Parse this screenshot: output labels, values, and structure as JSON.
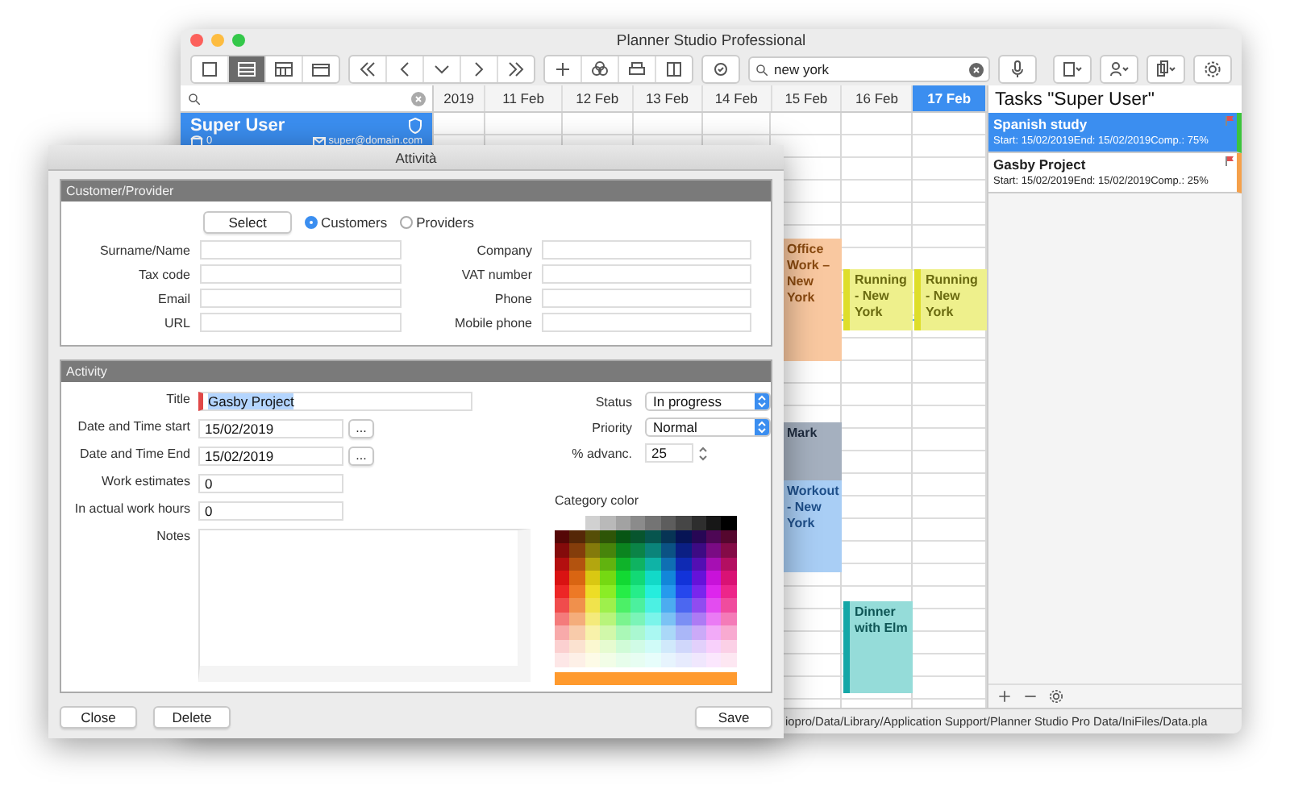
{
  "main_window": {
    "title": "Planner Studio Professional",
    "toolbar": {
      "search": "new york"
    },
    "sidebar": {
      "user": {
        "name": "Super User",
        "count": "0",
        "email": "super@domain.com",
        "selected": true
      }
    },
    "calendar": {
      "columns": [
        {
          "label": "2019",
          "selected": false
        },
        {
          "label": "11 Feb",
          "selected": false
        },
        {
          "label": "12 Feb",
          "selected": false
        },
        {
          "label": "13 Feb",
          "selected": false
        },
        {
          "label": "14 Feb",
          "selected": false
        },
        {
          "label": "15 Feb",
          "selected": false
        },
        {
          "label": "16 Feb",
          "selected": false
        },
        {
          "label": "17 Feb",
          "selected": true
        }
      ],
      "events": [
        {
          "title": "Office Work – New York",
          "color": "#f9c8a0"
        },
        {
          "title": "Running - New York",
          "color": "#eef08c"
        },
        {
          "title": "Running - New York",
          "color": "#eef08c"
        },
        {
          "title": "Mark",
          "color": "#a5b0bf"
        },
        {
          "title": "Workout - New York",
          "color": "#a9cef5"
        },
        {
          "title": "Dinner with Elm",
          "color": "#95dcd9"
        }
      ]
    },
    "tasks": {
      "title": "Tasks \"Super User\"",
      "items": [
        {
          "name": "Spanish study",
          "detail": "Start: 15/02/2019End: 15/02/2019Comp.: 75%",
          "selected": true,
          "color": "#3cc43c"
        },
        {
          "name": "Gasby Project",
          "detail": "Start: 15/02/2019End: 15/02/2019Comp.: 25%",
          "selected": false,
          "color": "#f5a04a"
        }
      ]
    },
    "status_bar": "iopro/Data/Library/Application Support/Planner Studio Pro Data/IniFiles/Data.pla"
  },
  "dialog": {
    "title": "Attività",
    "customer_section": {
      "title": "Customer/Provider",
      "select_button": "Select",
      "radios": [
        {
          "label": "Customers",
          "selected": true
        },
        {
          "label": "Providers",
          "selected": false
        }
      ],
      "fields_left": [
        {
          "label": "Surname/Name"
        },
        {
          "label": "Tax code"
        },
        {
          "label": "Email"
        },
        {
          "label": "URL"
        }
      ],
      "fields_right": [
        {
          "label": "Company"
        },
        {
          "label": "VAT number"
        },
        {
          "label": "Phone"
        },
        {
          "label": "Mobile phone"
        }
      ]
    },
    "activity_section": {
      "title": "Activity",
      "title_field": {
        "label": "Title",
        "value": "Gasby Project"
      },
      "date_start": {
        "label": "Date and Time start",
        "value": "15/02/2019",
        "button": "..."
      },
      "date_end": {
        "label": "Date and Time End",
        "value": "15/02/2019",
        "button": "..."
      },
      "work_estimates": {
        "label": "Work estimates",
        "value": "0"
      },
      "actual_hours": {
        "label": "In actual work hours",
        "value": "0"
      },
      "notes": {
        "label": "Notes"
      },
      "status": {
        "label": "Status",
        "value": "In progress"
      },
      "priority": {
        "label": "Priority",
        "value": "Normal"
      },
      "progress": {
        "label": "% advanc.",
        "value": "25"
      },
      "category_color": {
        "label": "Category color",
        "color": "#ff9a2e"
      }
    },
    "buttons": {
      "left": [
        "Close",
        "Delete"
      ],
      "right": [
        "Save"
      ]
    }
  }
}
